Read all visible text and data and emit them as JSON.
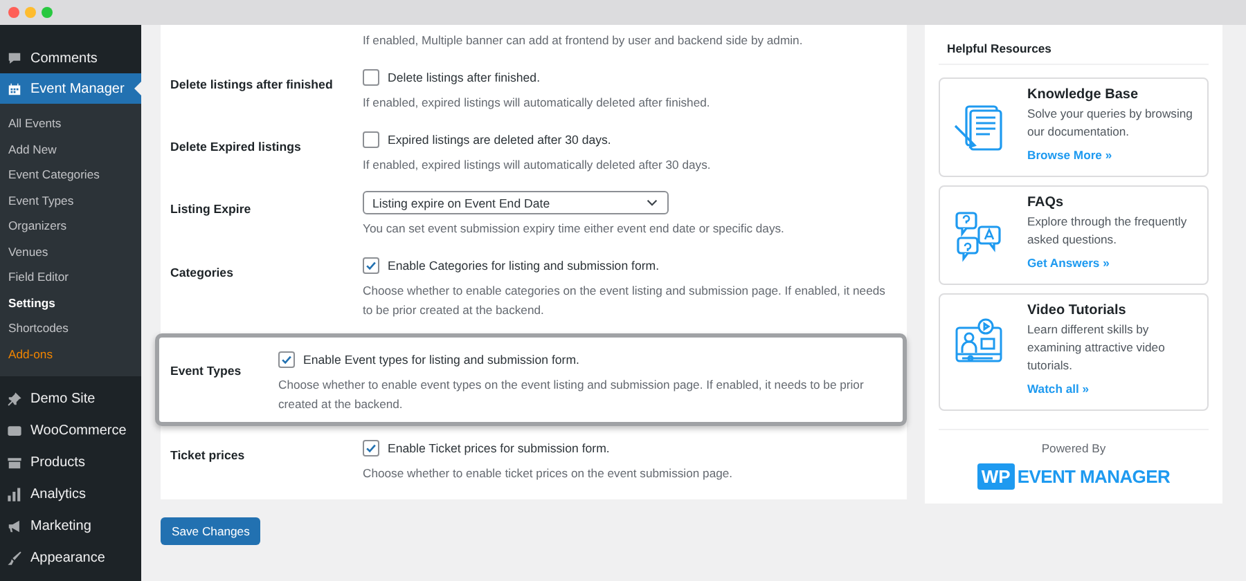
{
  "sidebar": {
    "items": [
      {
        "label": "Comments",
        "selected": false
      },
      {
        "label": "Event Manager",
        "selected": true,
        "expanded": true,
        "children": [
          {
            "label": "All Events",
            "selected": false,
            "kind": "page"
          },
          {
            "label": "Add New",
            "selected": false,
            "kind": "page"
          },
          {
            "label": "Event Categories",
            "selected": false,
            "kind": "page"
          },
          {
            "label": "Event Types",
            "selected": false,
            "kind": "page"
          },
          {
            "label": "Organizers",
            "selected": false,
            "kind": "page"
          },
          {
            "label": "Venues",
            "selected": false,
            "kind": "page"
          },
          {
            "label": "Field Editor",
            "selected": false,
            "kind": "page"
          },
          {
            "label": "Settings",
            "selected": true,
            "kind": "page"
          },
          {
            "label": "Shortcodes",
            "selected": false,
            "kind": "page"
          },
          {
            "label": "Add-ons",
            "selected": false,
            "kind": "addon"
          }
        ]
      },
      {
        "label": "Demo Site",
        "selected": false
      },
      {
        "label": "WooCommerce",
        "selected": false
      },
      {
        "label": "Products",
        "selected": false
      },
      {
        "label": "Analytics",
        "selected": false
      },
      {
        "label": "Marketing",
        "selected": false
      },
      {
        "label": "Appearance",
        "selected": false
      }
    ]
  },
  "settings": {
    "rows": [
      {
        "kind": "note",
        "description": "If enabled, Multiple banner can add at frontend by user and backend side by admin."
      },
      {
        "kind": "checkbox",
        "label": "Delete listings after finished",
        "checked": false,
        "option": "Delete listings after finished.",
        "description": "If enabled, expired listings will automatically deleted after finished."
      },
      {
        "kind": "checkbox",
        "label": "Delete Expired listings",
        "checked": false,
        "option": "Expired listings are deleted after 30 days.",
        "description": "If enabled, expired listings will automatically deleted after 30 days."
      },
      {
        "kind": "select",
        "label": "Listing Expire",
        "value": "Listing expire on Event End Date",
        "description": "You can set event submission expiry time either event end date or specific days."
      },
      {
        "kind": "checkbox",
        "label": "Categories",
        "checked": true,
        "option": "Enable Categories for listing and submission form.",
        "description": "Choose whether to enable categories on the event listing and submission page. If enabled, it needs to be prior created at the backend."
      },
      {
        "kind": "checkbox",
        "label": "Event Types",
        "checked": true,
        "highlighted": true,
        "option": "Enable Event types for listing and submission form.",
        "description": "Choose whether to enable event types on the event listing and submission page. If enabled, it needs to be prior created at the backend."
      },
      {
        "kind": "checkbox",
        "label": "Ticket prices",
        "checked": true,
        "option": "Enable Ticket prices for submission form.",
        "description": "Choose whether to enable ticket prices on the event submission page."
      }
    ],
    "save_button": "Save Changes"
  },
  "resources": {
    "title": "Helpful Resources",
    "cards": [
      {
        "title": "Knowledge Base",
        "text": "Solve your queries by browsing our documentation.",
        "link": "Browse More »"
      },
      {
        "title": "FAQs",
        "text": "Explore through the frequently asked questions.",
        "link": "Get Answers »"
      },
      {
        "title": "Video Tutorials",
        "text": "Learn different skills by examining attractive video tutorials.",
        "link": "Watch all »"
      }
    ],
    "powered_by": "Powered By",
    "logo": {
      "badge": "WP",
      "name": "EVENT MANAGER"
    }
  }
}
